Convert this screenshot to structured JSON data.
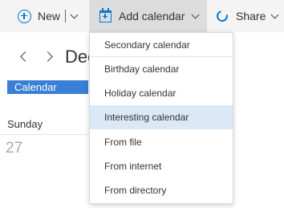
{
  "toolbar": {
    "new_label": "New",
    "add_calendar_label": "Add calendar",
    "share_label": "Share"
  },
  "calendar": {
    "month_title": "Dec",
    "badge_label": "Calendar",
    "day_name": "Sunday",
    "day_number": "27"
  },
  "dropdown": {
    "items": [
      {
        "label": "Secondary calendar"
      },
      {
        "label": "Birthday calendar"
      },
      {
        "label": "Holiday calendar"
      },
      {
        "label": "Interesting calendar",
        "highlighted": true
      },
      {
        "label": "From file"
      },
      {
        "label": "From internet"
      },
      {
        "label": "From directory"
      }
    ]
  },
  "colors": {
    "accent": "#0078d7",
    "badge": "#3a7fd5",
    "highlight": "#dbe8f6",
    "toolbar_bg": "#f4f4f4"
  },
  "icons": [
    "plus-circle-icon",
    "calendar-add-icon",
    "share-icon",
    "chevron-down-icon",
    "chevron-left-icon",
    "chevron-right-icon"
  ]
}
